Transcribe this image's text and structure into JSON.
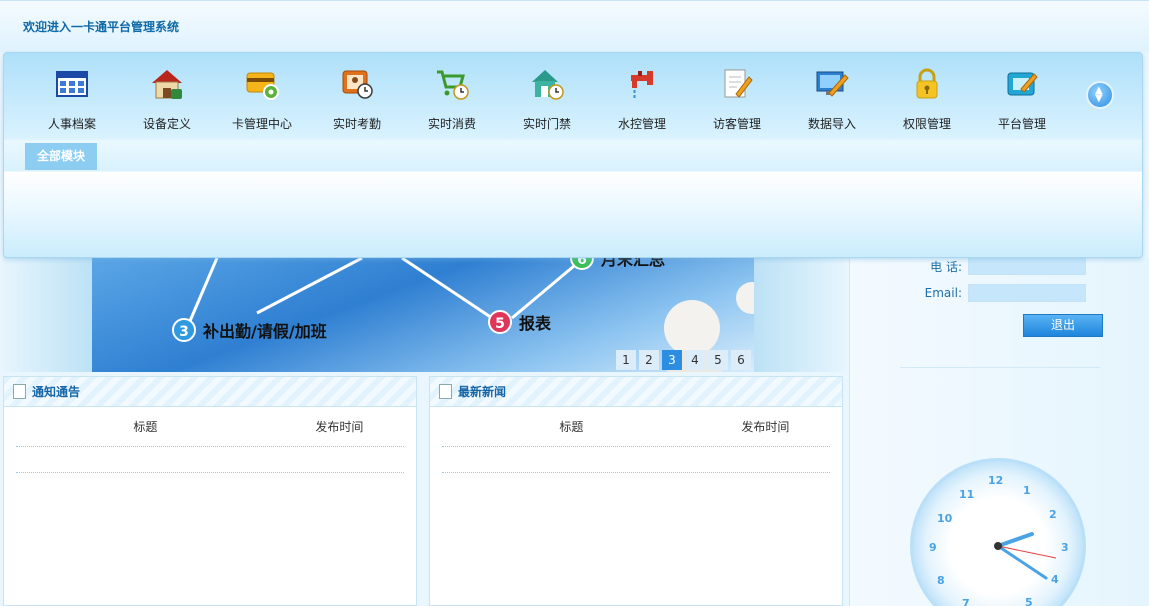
{
  "header": {
    "welcome": "欢迎进入一卡通平台管理系统"
  },
  "menu": {
    "items": [
      {
        "label": "人事档案",
        "icon": "personnel-grid-icon"
      },
      {
        "label": "设备定义",
        "icon": "house-device-icon"
      },
      {
        "label": "卡管理中心",
        "icon": "card-gear-icon"
      },
      {
        "label": "实时考勤",
        "icon": "attendance-clock-icon"
      },
      {
        "label": "实时消费",
        "icon": "cart-clock-icon"
      },
      {
        "label": "实时门禁",
        "icon": "door-house-clock-icon"
      },
      {
        "label": "水控管理",
        "icon": "faucet-icon"
      },
      {
        "label": "访客管理",
        "icon": "visitor-document-icon"
      },
      {
        "label": "数据导入",
        "icon": "monitor-pen-icon"
      },
      {
        "label": "权限管理",
        "icon": "padlock-icon"
      },
      {
        "label": "平台管理",
        "icon": "platform-edit-icon"
      }
    ],
    "all_modules": "全部模块",
    "toggle_icon": "collapse-toggle-icon"
  },
  "banner": {
    "step3": {
      "num": "3",
      "label": "补出勤/请假/加班"
    },
    "step5": {
      "num": "5",
      "label": "报表"
    },
    "step6": {
      "num": "6",
      "label": "月末汇总"
    },
    "pages": [
      "1",
      "2",
      "3",
      "4",
      "5",
      "6"
    ],
    "active_page": "3"
  },
  "user": {
    "phone_label": "电  话:",
    "phone_value": "",
    "email_label": "Email:",
    "email_value": "",
    "logout": "退出"
  },
  "notice": {
    "title": "通知通告",
    "col_title": "标题",
    "col_time": "发布时间"
  },
  "news": {
    "title": "最新新闻",
    "col_title": "标题",
    "col_time": "发布时间"
  },
  "clock": {
    "numbers": [
      "12",
      "1",
      "2",
      "3",
      "4",
      "5",
      "6",
      "7",
      "8",
      "9",
      "10",
      "11"
    ]
  },
  "colors": {
    "accent": "#2c8ee0",
    "title_text": "#0f6aa8",
    "panel_border": "#c8e3f4"
  }
}
